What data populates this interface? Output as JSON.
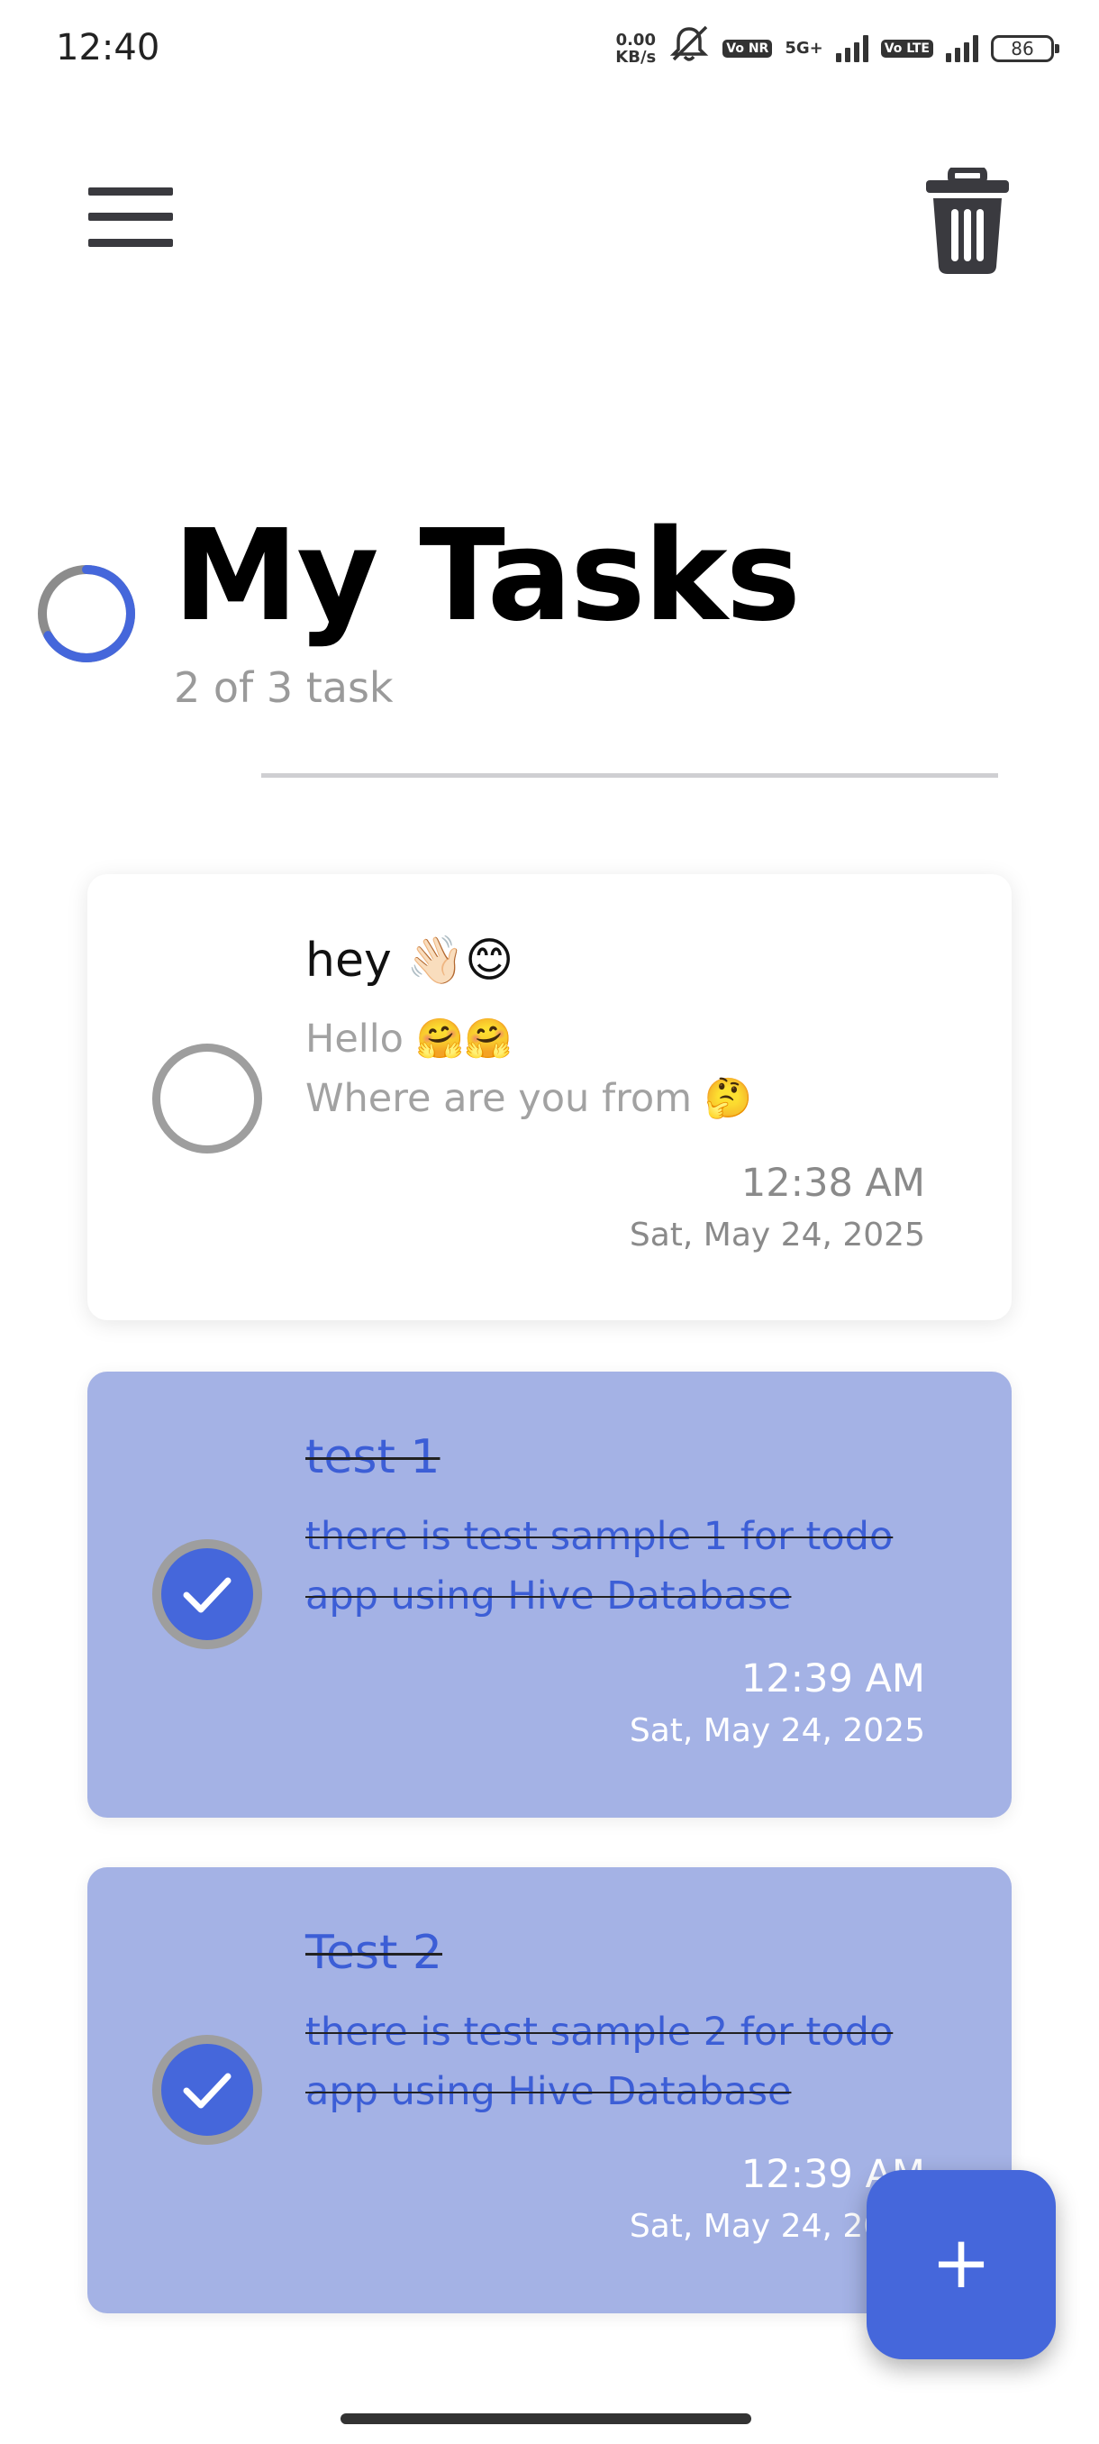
{
  "status_bar": {
    "time": "12:40",
    "net_speed_value": "0.00",
    "net_speed_unit": "KB/s",
    "mute_icon": "bell-off-icon",
    "volte_badge_1": "Vo NR",
    "network_type": "5G+",
    "volte_badge_2": "Vo LTE",
    "battery": "86"
  },
  "header": {
    "menu_icon": "hamburger-menu-icon",
    "delete_icon": "trash-icon"
  },
  "summary": {
    "title": "My Tasks",
    "subtitle": "2 of 3 task",
    "completed": 2,
    "total": 3,
    "accent_color": "#4567db"
  },
  "tasks": [
    {
      "title": "hey 👋🏻😊",
      "description": "Hello 🤗🤗\nWhere are you from 🤔",
      "time": "12:38 AM",
      "date": "Sat, May 24, 2025",
      "completed": false
    },
    {
      "title": "test 1",
      "description": "there is test sample 1 for  todo app using Hive Database",
      "time": "12:39 AM",
      "date": "Sat, May 24, 2025",
      "completed": true
    },
    {
      "title": "Test 2",
      "description": "there is test sample 2 for  todo app using Hive Database",
      "time": "12:39 AM",
      "date": "Sat, May 24, 2025",
      "completed": true
    }
  ],
  "fab": {
    "label": "+",
    "icon": "plus-icon"
  },
  "colors": {
    "done_card": "#a4b2e5",
    "done_text": "#3c5ed6"
  }
}
